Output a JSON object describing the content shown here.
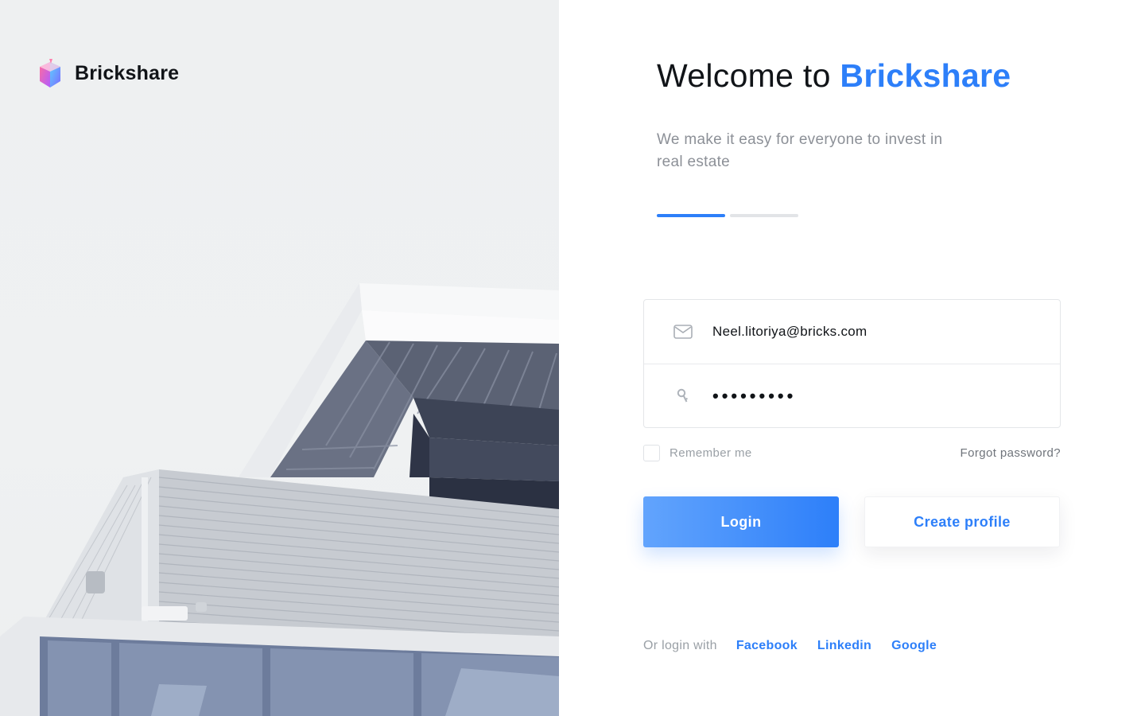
{
  "brand": {
    "name": "Brickshare",
    "logo_icon": "brickshare-logo-icon"
  },
  "welcome": {
    "prefix": "Welcome to",
    "accent": "Brickshare"
  },
  "tagline": "We make it easy for everyone to invest in real estate",
  "steps": {
    "total": 2,
    "active_index": 0
  },
  "form": {
    "email": {
      "value": "Neel.litoriya@bricks.com",
      "icon": "mail-icon"
    },
    "password": {
      "value": "•••••••••",
      "icon": "key-icon"
    },
    "remember_label": "Remember me",
    "remember_checked": false,
    "forgot_label": "Forgot password?"
  },
  "buttons": {
    "login": "Login",
    "create": "Create profile"
  },
  "social": {
    "label": "Or login with",
    "links": [
      "Facebook",
      "Linkedin",
      "Google"
    ]
  },
  "colors": {
    "accent": "#2d7ff9",
    "text": "#111418",
    "muted": "#8c9097"
  }
}
